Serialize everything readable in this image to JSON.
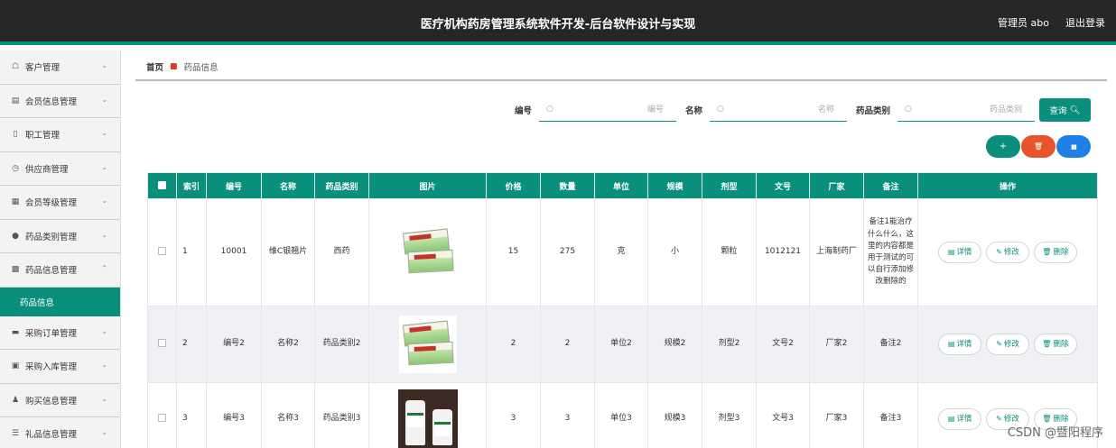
{
  "header": {
    "title": "医疗机构药房管理系统软件开发-后台软件设计与实现",
    "user": "管理员 abo",
    "logout": "退出登录"
  },
  "sidebar": {
    "items": [
      {
        "label": "客户管理",
        "icon": "user-outline-icon"
      },
      {
        "label": "会员信息管理",
        "icon": "card-icon"
      },
      {
        "label": "职工管理",
        "icon": "badge-icon"
      },
      {
        "label": "供应商管理",
        "icon": "clock-icon"
      },
      {
        "label": "会员等级管理",
        "icon": "list-icon"
      },
      {
        "label": "药品类别管理",
        "icon": "pin-icon"
      },
      {
        "label": "药品信息管理",
        "icon": "grid-icon"
      },
      {
        "label": "采购订单管理",
        "icon": "monitor-icon"
      },
      {
        "label": "采购入库管理",
        "icon": "box-icon"
      },
      {
        "label": "购买信息管理",
        "icon": "person-icon"
      },
      {
        "label": "礼品信息管理",
        "icon": "sliders-icon"
      }
    ],
    "sub_item": "药品信息"
  },
  "breadcrumb": {
    "home": "首页",
    "current": "药品信息"
  },
  "search": {
    "fields": [
      {
        "label": "编号",
        "placeholder": "编号"
      },
      {
        "label": "名称",
        "placeholder": "名称"
      },
      {
        "label": "药品类别",
        "placeholder": "药品类别"
      }
    ],
    "query_label": "查询"
  },
  "actions": {
    "add": "+",
    "delete": "🗑",
    "chart": "▮▮"
  },
  "table": {
    "headers": [
      "索引",
      "编号",
      "名称",
      "药品类别",
      "图片",
      "价格",
      "数量",
      "单位",
      "规模",
      "剂型",
      "文号",
      "厂家",
      "备注",
      "操作"
    ],
    "rows": [
      {
        "index": "1",
        "code": "10001",
        "name": "维C银翘片",
        "category": "西药",
        "price": "15",
        "qty": "275",
        "unit": "克",
        "scale": "小",
        "form": "颗粒",
        "doc": "1012121",
        "maker": "上海制药厂",
        "remark": "备注1能治疗什么什么，这里的内容都是用于测试的可以自行添加修改删除的"
      },
      {
        "index": "2",
        "code": "编号2",
        "name": "名称2",
        "category": "药品类别2",
        "price": "2",
        "qty": "2",
        "unit": "单位2",
        "scale": "规模2",
        "form": "剂型2",
        "doc": "文号2",
        "maker": "厂家2",
        "remark": "备注2"
      },
      {
        "index": "3",
        "code": "编号3",
        "name": "名称3",
        "category": "药品类别3",
        "price": "3",
        "qty": "3",
        "unit": "单位3",
        "scale": "规模3",
        "form": "剂型3",
        "doc": "文号3",
        "maker": "厂家3",
        "remark": "备注3"
      }
    ],
    "ops": {
      "detail": "详情",
      "edit": "修改",
      "delete": "删除"
    }
  },
  "watermark": "CSDN @暨阳程序"
}
